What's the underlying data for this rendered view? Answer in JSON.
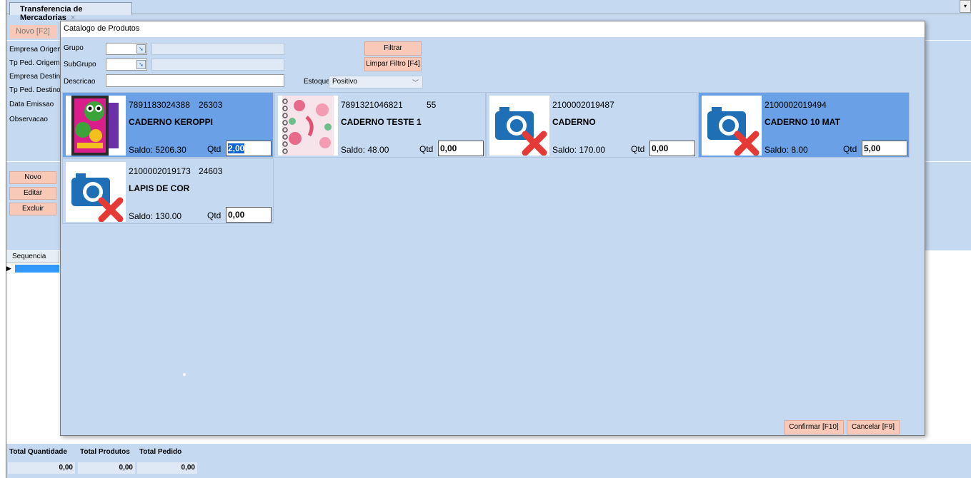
{
  "main_tab": {
    "title": "Transferencia de Mercadorias",
    "close": "×"
  },
  "tab_menu_icon": "▾",
  "bg_toolbar": {
    "novo": "Novo [F2]"
  },
  "bg_labels": [
    "Empresa Origem",
    "Tp Ped. Origem",
    "Empresa Destino",
    "Tp Ped. Destino",
    "Data Emissao",
    "Observacao"
  ],
  "bg_buttons": [
    "Novo",
    "Editar",
    "Excluir"
  ],
  "grid": {
    "header": "Sequencia",
    "indicator": "▶"
  },
  "totals": {
    "headers": [
      "Total Quantidade",
      "Total Produtos",
      "Total Pedido"
    ],
    "values": [
      "0,00",
      "0,00",
      "0,00"
    ]
  },
  "dialog": {
    "title": "Catalogo de Produtos",
    "filters": {
      "grupo_label": "Grupo",
      "subgrupo_label": "SubGrupo",
      "descricao_label": "Descricao",
      "descricao_value": "",
      "estoque_label": "Estoque",
      "estoque_value": "Positivo",
      "filtrar": "Filtrar",
      "limpar": "Limpar Filtro [F4]"
    },
    "products": [
      {
        "code": "7891183024388",
        "ref": "26303",
        "name": "CADERNO KEROPPI",
        "saldo": "Saldo: 5206.30",
        "qtd_label": "Qtd",
        "qtd": "2,00",
        "image": "keroppi-notebook-image",
        "selected": true
      },
      {
        "code": "7891321046821",
        "ref": "55",
        "name": "CADERNO TESTE 1",
        "saldo": "Saldo: 48.00",
        "qtd_label": "Qtd",
        "qtd": "0,00",
        "image": "floral-notebook-image",
        "selected": false
      },
      {
        "code": "2100002019487",
        "ref": "",
        "name": "CADERNO",
        "saldo": "Saldo: 170.00",
        "qtd_label": "Qtd",
        "qtd": "0,00",
        "image": "no-image-camera-icon",
        "selected": false
      },
      {
        "code": "2100002019494",
        "ref": "",
        "name": "CADERNO 10 MAT",
        "saldo": "Saldo: 8.00",
        "qtd_label": "Qtd",
        "qtd": "5,00",
        "image": "no-image-camera-icon",
        "selected": true
      },
      {
        "code": "2100002019173",
        "ref": "24603",
        "name": "LAPIS DE COR",
        "saldo": "Saldo: 130.00",
        "qtd_label": "Qtd",
        "qtd": "0,00",
        "image": "no-image-camera-icon",
        "selected": false
      }
    ],
    "confirm": "Confirmar [F10]",
    "cancel": "Cancelar [F9]"
  },
  "colors": {
    "panel": "#c5d9f1",
    "button": "#f8c9b8",
    "selected_card": "#6aa0e6",
    "no_image_x": "#e53935",
    "camera": "#1e6fb5"
  }
}
